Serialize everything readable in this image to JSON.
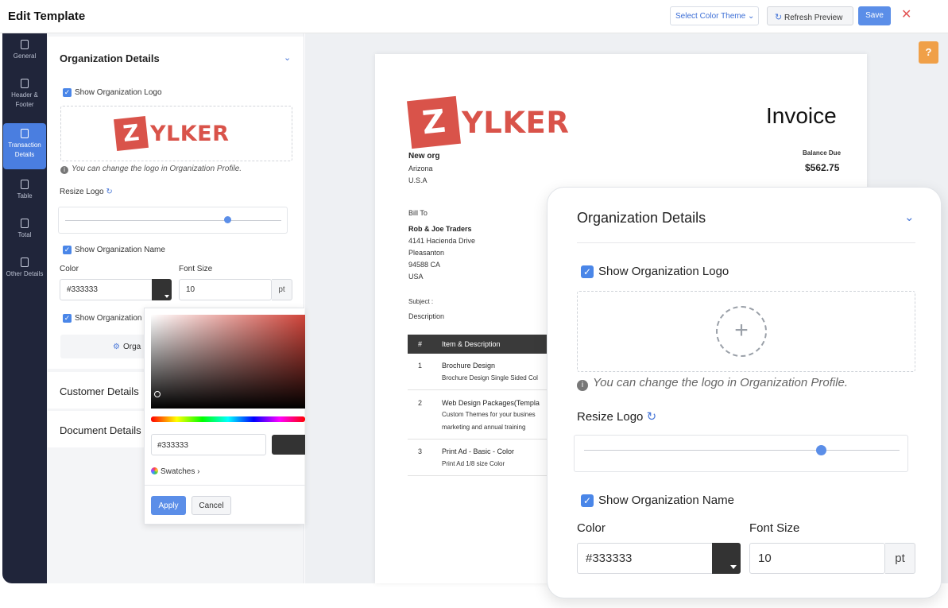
{
  "topbar": {
    "title": "Edit Template",
    "theme_select": "Select Color Theme",
    "refresh_label": "Refresh Preview",
    "save_label": "Save",
    "close_glyph": "✕"
  },
  "nav": {
    "items": [
      {
        "label": "General",
        "icon": "general-icon"
      },
      {
        "label": "Header & Footer",
        "icon": "header-footer-icon"
      },
      {
        "label": "Transaction Details",
        "icon": "transaction-details-icon",
        "active": true
      },
      {
        "label": "Table",
        "icon": "table-icon"
      },
      {
        "label": "Total",
        "icon": "total-icon"
      },
      {
        "label": "Other Details",
        "icon": "other-details-icon"
      }
    ]
  },
  "panel": {
    "org_title": "Organization Details",
    "show_logo": "Show Organization Logo",
    "logo_note": "You can change the logo in Organization Profile.",
    "resize_logo": "Resize Logo",
    "resize_value": 0.75,
    "show_name": "Show Organization Name",
    "color_label": "Color",
    "font_size_label": "Font Size",
    "color_value": "#333333",
    "font_size_value": "10",
    "font_unit": "pt",
    "show_address": "Show Organization",
    "address_btn": "Orga",
    "customer_title": "Customer Details",
    "document_title": "Document Details"
  },
  "logo": {
    "mark": "Z",
    "rest": "YLKER",
    "color": "#d9534a"
  },
  "picker": {
    "hex_value": "#333333",
    "swatches_label": "Swatches",
    "apply_label": "Apply",
    "cancel_label": "Cancel"
  },
  "help": {
    "glyph": "?"
  },
  "invoice": {
    "title": "Invoice",
    "org_name": "New org",
    "org_state": "Arizona",
    "org_country": "U.S.A",
    "balance_label": "Balance Due",
    "balance_value": "$562.75",
    "bill_to": "Bill To",
    "customer": "Rob & Joe Traders",
    "addr1": "4141 Hacienda Drive",
    "addr2": "Pleasanton",
    "addr3": "94588 CA",
    "addr4": "USA",
    "subject": "Subject :",
    "description": "Description",
    "head_num": "#",
    "head_item": "Item & Description",
    "rows": [
      {
        "num": "1",
        "name": "Brochure Design",
        "desc": "Brochure Design Single Sided Col",
        "desc2": ""
      },
      {
        "num": "2",
        "name": "Web Design Packages(Templa",
        "desc": "Custom Themes for your busines",
        "desc2": "marketing and annual training"
      },
      {
        "num": "3",
        "name": "Print Ad - Basic - Color",
        "desc": "Print Ad 1/8 size Color",
        "desc2": ""
      }
    ]
  },
  "zoom": {
    "title": "Organization Details",
    "show_logo": "Show Organization Logo",
    "plus": "+",
    "note": "You can change the logo in Organization Profile.",
    "resize_logo": "Resize Logo",
    "resize_value": 0.75,
    "show_name": "Show Organization Name",
    "color_label": "Color",
    "font_size_label": "Font Size",
    "color_value": "#333333",
    "font_size_value": "10",
    "font_unit": "pt"
  }
}
